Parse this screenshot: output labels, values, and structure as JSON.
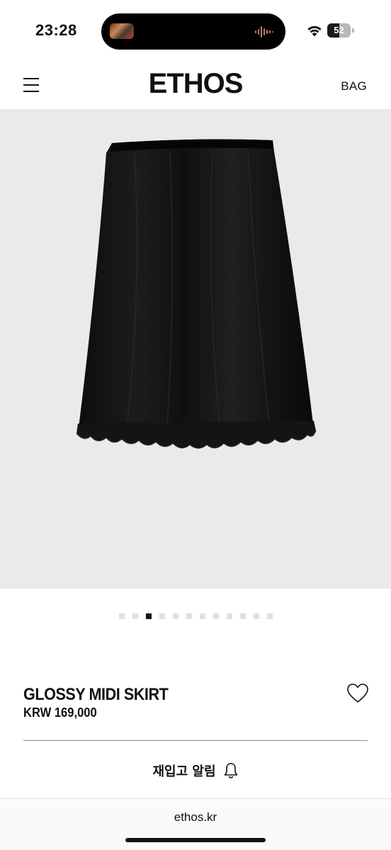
{
  "status_bar": {
    "time": "23:28",
    "battery": "52",
    "battery_level": 0.52
  },
  "header": {
    "brand": "ETHOS",
    "bag_label": "BAG"
  },
  "carousel": {
    "total": 12,
    "active_index": 2
  },
  "product": {
    "name": "GLOSSY MIDI SKIRT",
    "price": "KRW 169,000"
  },
  "restock": {
    "label": "재입고 알림"
  },
  "browser": {
    "url": "ethos.kr"
  },
  "colors": {
    "image_bg": "#ebeaea",
    "text": "#111111",
    "dot_inactive": "#e0e0e0",
    "dot_active": "#111111"
  }
}
